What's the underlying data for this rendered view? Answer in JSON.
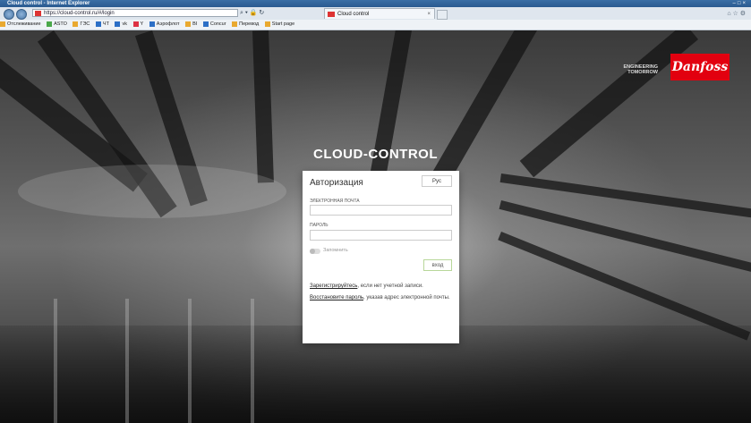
{
  "browser": {
    "window_title": "Cloud control - Internet Explorer",
    "url": "https://cloud-control.ru/#/login",
    "tab_title": "Cloud control",
    "favorites": [
      "Отслеживание",
      "ASTO",
      "ГЭС",
      "ЧТ",
      "vk",
      "Y",
      "Аэрофлот",
      "BI",
      "Concur",
      "Перевод",
      "Start page"
    ]
  },
  "brand": {
    "tagline_line1": "ENGINEERING",
    "tagline_line2": "TOMORROW",
    "logo_text": "Danfoss",
    "logo_color": "#e2000f"
  },
  "app_title": "CLOUD-CONTROL",
  "login": {
    "heading": "Авторизация",
    "language": "Рус",
    "email_label": "ЭЛЕКТРОННАЯ ПОЧТА",
    "email_value": "",
    "password_label": "ПАРОЛЬ",
    "password_value": "",
    "remember_label": "Запомнить",
    "remember_checked": false,
    "submit_label": "вход",
    "register_link": "Зарегистрируйтесь",
    "register_rest": ", если нет учетной записи.",
    "restore_link": "Восстановите пароль",
    "restore_rest": ", указав адрес электронной почты."
  }
}
